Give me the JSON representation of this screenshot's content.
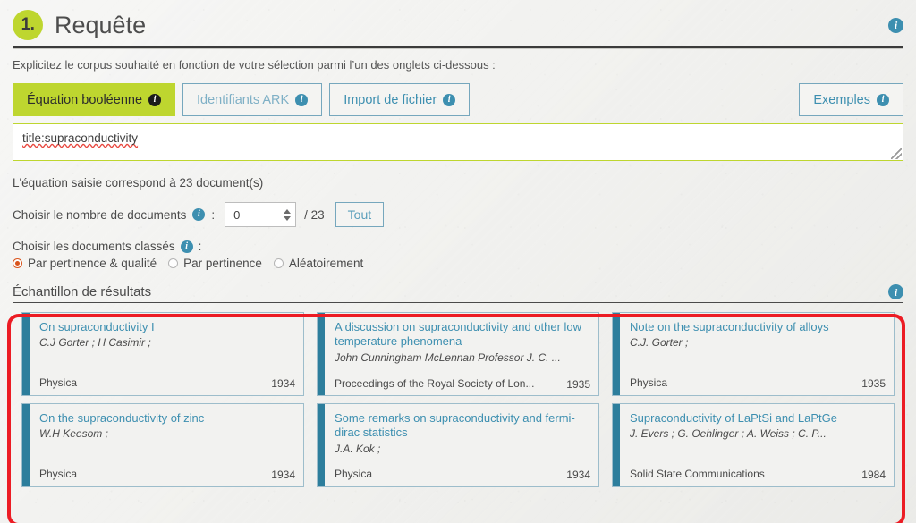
{
  "header": {
    "step": "1.",
    "title": "Requête",
    "info_icon": "info-icon"
  },
  "intro": "Explicitez le corpus souhaité en fonction de votre sélection parmi l’un des onglets ci-dessous :",
  "tabs": [
    {
      "label": "Équation booléenne",
      "active": true
    },
    {
      "label": "Identifiants ARK",
      "active": false
    },
    {
      "label": "Import de fichier",
      "active": false
    }
  ],
  "examples_button": {
    "label": "Exemples"
  },
  "query": {
    "value": "title:supraconductivity",
    "placeholder": ""
  },
  "result_count_text": "L'équation saisie correspond à  23 document(s)",
  "documents": {
    "label": "Choisir le nombre de documents",
    "colon": ":",
    "value": "0",
    "total": "/ 23",
    "all_button": "Tout"
  },
  "sorting": {
    "label": "Choisir les documents classés",
    "colon": ":",
    "options": [
      {
        "label": "Par pertinence & qualité",
        "selected": true
      },
      {
        "label": "Par pertinence",
        "selected": false
      },
      {
        "label": "Aléatoirement",
        "selected": false
      }
    ]
  },
  "results": {
    "title": "Échantillon de résultats",
    "cards": [
      {
        "title": "On supraconductivity I",
        "authors": "C.J Gorter ; H Casimir ;",
        "journal": "Physica",
        "year": "1934"
      },
      {
        "title": "A discussion on supraconductivity and other low temperature phenomena",
        "authors": "John Cunningham McLennan Professor J. C. ...",
        "journal": "Proceedings of the Royal Society of Lon...",
        "year": "1935"
      },
      {
        "title": "Note on the supraconductivity of alloys",
        "authors": "C.J. Gorter ;",
        "journal": "Physica",
        "year": "1935"
      },
      {
        "title": "On the supraconductivity of zinc",
        "authors": "W.H Keesom ;",
        "journal": "Physica",
        "year": "1934"
      },
      {
        "title": "Some remarks on supraconductivity and fermi-dirac statistics",
        "authors": "J.A. Kok ;",
        "journal": "Physica",
        "year": "1934"
      },
      {
        "title": "Supraconductivity of LaPtSi and LaPtGe",
        "authors": "J. Evers ; G. Oehlinger ; A. Weiss ; C. P...",
        "journal": "Solid State Communications",
        "year": "1984"
      }
    ]
  },
  "colors": {
    "accent_green": "#bed62f",
    "accent_blue": "#3d8fb0",
    "card_bar": "#2d7e9c",
    "radio_selected": "#d9541c",
    "highlight_red": "#ec1c24",
    "background": "#eeeeeb"
  }
}
